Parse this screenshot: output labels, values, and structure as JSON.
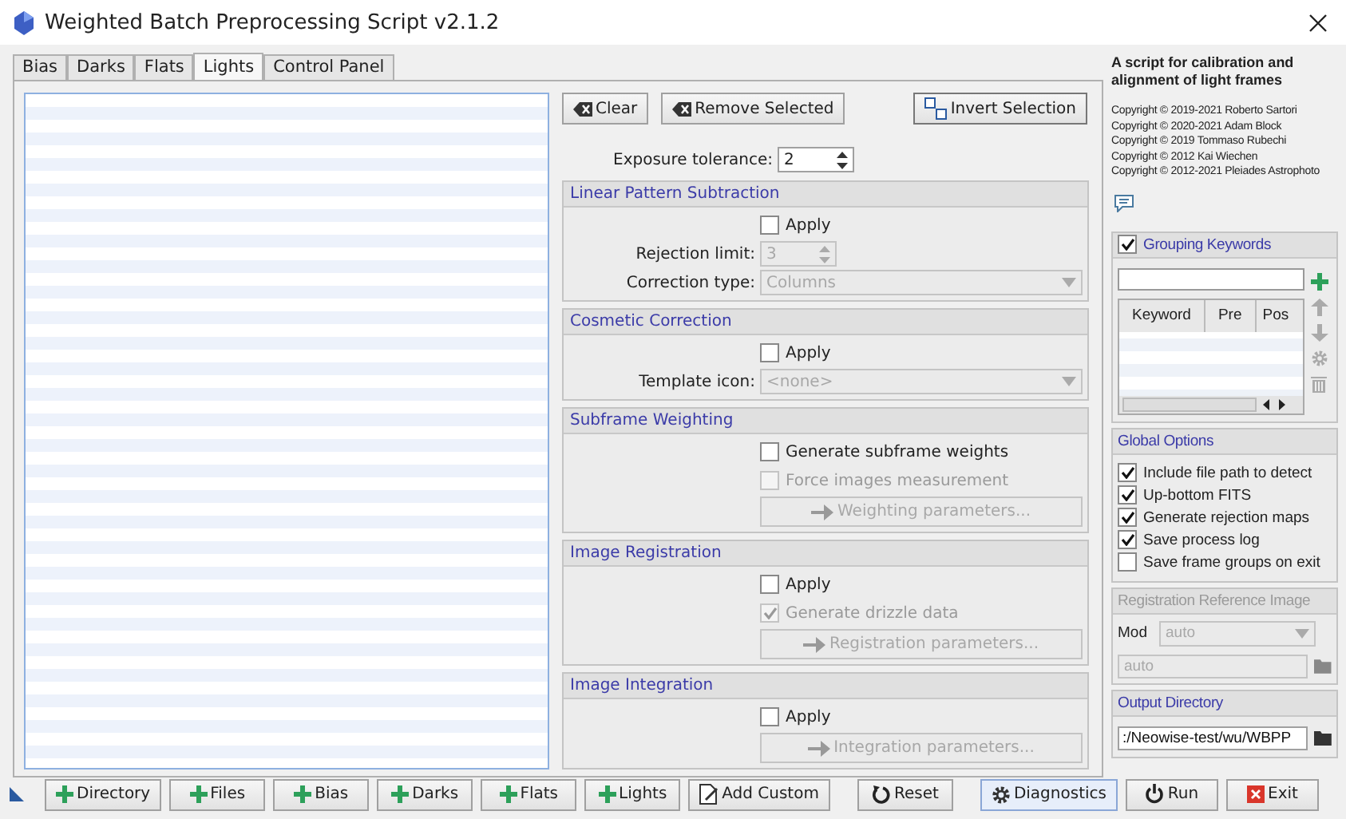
{
  "window": {
    "title": "Weighted Batch Preprocessing Script v2.1.2"
  },
  "tabs": [
    {
      "label": "Bias",
      "selected": false
    },
    {
      "label": "Darks",
      "selected": false
    },
    {
      "label": "Flats",
      "selected": false
    },
    {
      "label": "Lights",
      "selected": true
    },
    {
      "label": "Control Panel",
      "selected": false
    }
  ],
  "list_buttons": [
    {
      "label": "Clear",
      "kind": "clear"
    },
    {
      "label": "Remove Selected",
      "kind": "clear"
    },
    {
      "label": "Invert Selection",
      "kind": "invert"
    }
  ],
  "exposure_tolerance": {
    "label": "Exposure tolerance:",
    "value": "2"
  },
  "sections": [
    {
      "title": "Linear Pattern Subtraction",
      "items": [
        {
          "kind": "checkbox",
          "label": "Apply",
          "checked": false,
          "disabled": false
        },
        {
          "kind": "spin",
          "label": "Rejection limit:",
          "value": "3",
          "disabled": true
        },
        {
          "kind": "select",
          "label": "Correction type:",
          "value": "Columns",
          "disabled": true
        }
      ]
    },
    {
      "title": "Cosmetic Correction",
      "items": [
        {
          "kind": "checkbox",
          "label": "Apply",
          "checked": false,
          "disabled": false
        },
        {
          "kind": "select",
          "label": "Template icon:",
          "value": "<none>",
          "disabled": true
        }
      ]
    },
    {
      "title": "Subframe Weighting",
      "items": [
        {
          "kind": "checkbox",
          "label": "Generate subframe weights",
          "checked": false,
          "disabled": false
        },
        {
          "kind": "checkbox",
          "label": "Force images measurement",
          "checked": false,
          "disabled": true
        },
        {
          "kind": "button",
          "label": "Weighting parameters...",
          "disabled": true
        }
      ]
    },
    {
      "title": "Image Registration",
      "items": [
        {
          "kind": "checkbox",
          "label": "Apply",
          "checked": false,
          "disabled": false
        },
        {
          "kind": "checkbox",
          "label": "Generate drizzle data",
          "checked": true,
          "disabled": true
        },
        {
          "kind": "button",
          "label": "Registration parameters...",
          "disabled": true
        }
      ]
    },
    {
      "title": "Image Integration",
      "items": [
        {
          "kind": "checkbox",
          "label": "Apply",
          "checked": false,
          "disabled": false
        },
        {
          "kind": "button",
          "label": "Integration parameters...",
          "disabled": true
        }
      ]
    }
  ],
  "about": {
    "heading": "A script for calibration and alignment of light frames",
    "copyrights": [
      "Copyright © 2019-2021 Roberto Sartori",
      "Copyright © 2020-2021 Adam Block",
      "Copyright © 2019 Tommaso Rubechi",
      "Copyright © 2012 Kai Wiechen",
      "Copyright © 2012-2021 Pleiades Astrophoto"
    ]
  },
  "grouping_keywords": {
    "title": "Grouping Keywords",
    "checked": true,
    "columns": [
      "Keyword",
      "Pre",
      "Pos"
    ]
  },
  "global_options": {
    "title": "Global Options",
    "options": [
      {
        "label": "Include file path to detect",
        "checked": true
      },
      {
        "label": "Up-bottom FITS",
        "checked": true
      },
      {
        "label": "Generate rejection maps",
        "checked": true
      },
      {
        "label": "Save process log",
        "checked": true
      },
      {
        "label": "Save frame groups on exit",
        "checked": false
      }
    ]
  },
  "registration_reference": {
    "title": "Registration Reference Image",
    "disabled": true,
    "mode_label": "Mod",
    "mode_value": "auto",
    "path": "auto"
  },
  "output_directory": {
    "title": "Output Directory",
    "value": ":/Neowise-test/wu/WBPP"
  },
  "bottom_buttons": [
    {
      "label": "Directory",
      "kind": "add",
      "focused": false
    },
    {
      "label": "Files",
      "kind": "add",
      "focused": false
    },
    {
      "label": "Bias",
      "kind": "add",
      "focused": false
    },
    {
      "label": "Darks",
      "kind": "add",
      "focused": false
    },
    {
      "label": "Flats",
      "kind": "add",
      "focused": false
    },
    {
      "label": "Lights",
      "kind": "add",
      "focused": false
    },
    {
      "label": "Add Custom",
      "kind": "custom",
      "focused": false
    },
    {
      "label": "Reset",
      "kind": "reset",
      "focused": false
    },
    {
      "label": "Diagnostics",
      "kind": "diagnostics",
      "focused": true
    },
    {
      "label": "Run",
      "kind": "run",
      "focused": false
    },
    {
      "label": "Exit",
      "kind": "exit",
      "focused": false
    }
  ]
}
